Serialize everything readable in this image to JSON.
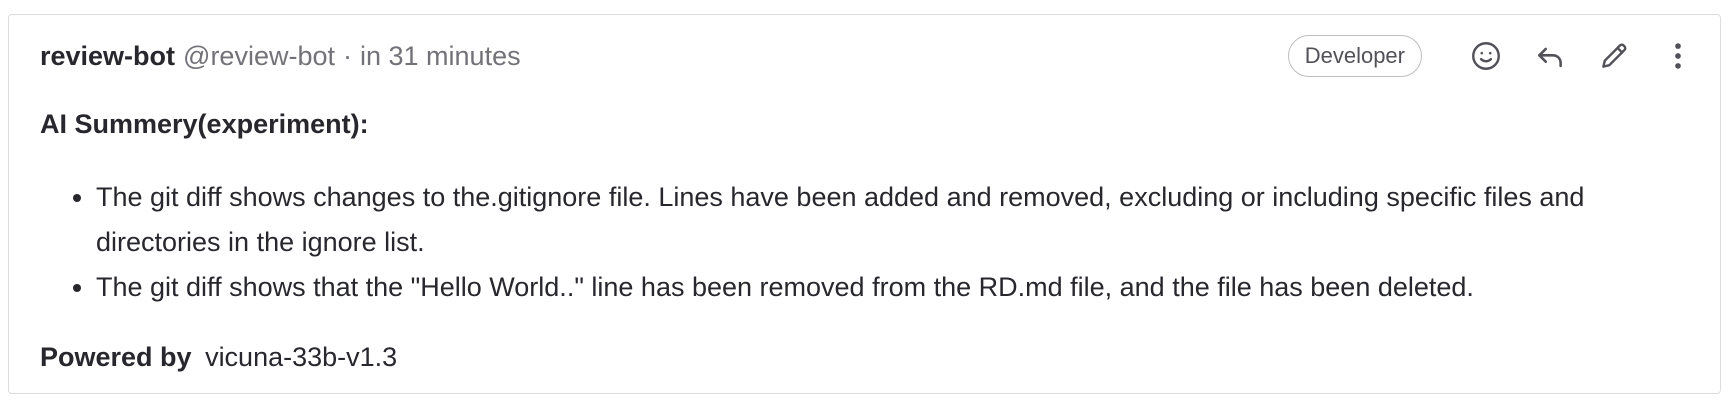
{
  "note": {
    "author_name": "review-bot",
    "author_handle": "@review-bot",
    "separator": "·",
    "timestamp": "in 31 minutes",
    "role_badge": "Developer"
  },
  "actions": {
    "icons": [
      "smiley-icon",
      "reply-icon",
      "pencil-icon",
      "more-vertical-icon"
    ]
  },
  "body": {
    "heading": "AI Summery(experiment):",
    "bullets": [
      "The git diff shows changes to the.gitignore file. Lines have been added and removed, excluding or including specific files and directories in the ignore list.",
      "The git diff shows that the \"Hello World..\" line has been removed from the RD.md file, and the file has been deleted."
    ],
    "powered_label": "Powered by",
    "model_name": "vicuna-33b-v1.3"
  },
  "colors": {
    "text": "#28272d",
    "muted": "#737278",
    "border": "#dcdcde",
    "icon": "#535158"
  }
}
